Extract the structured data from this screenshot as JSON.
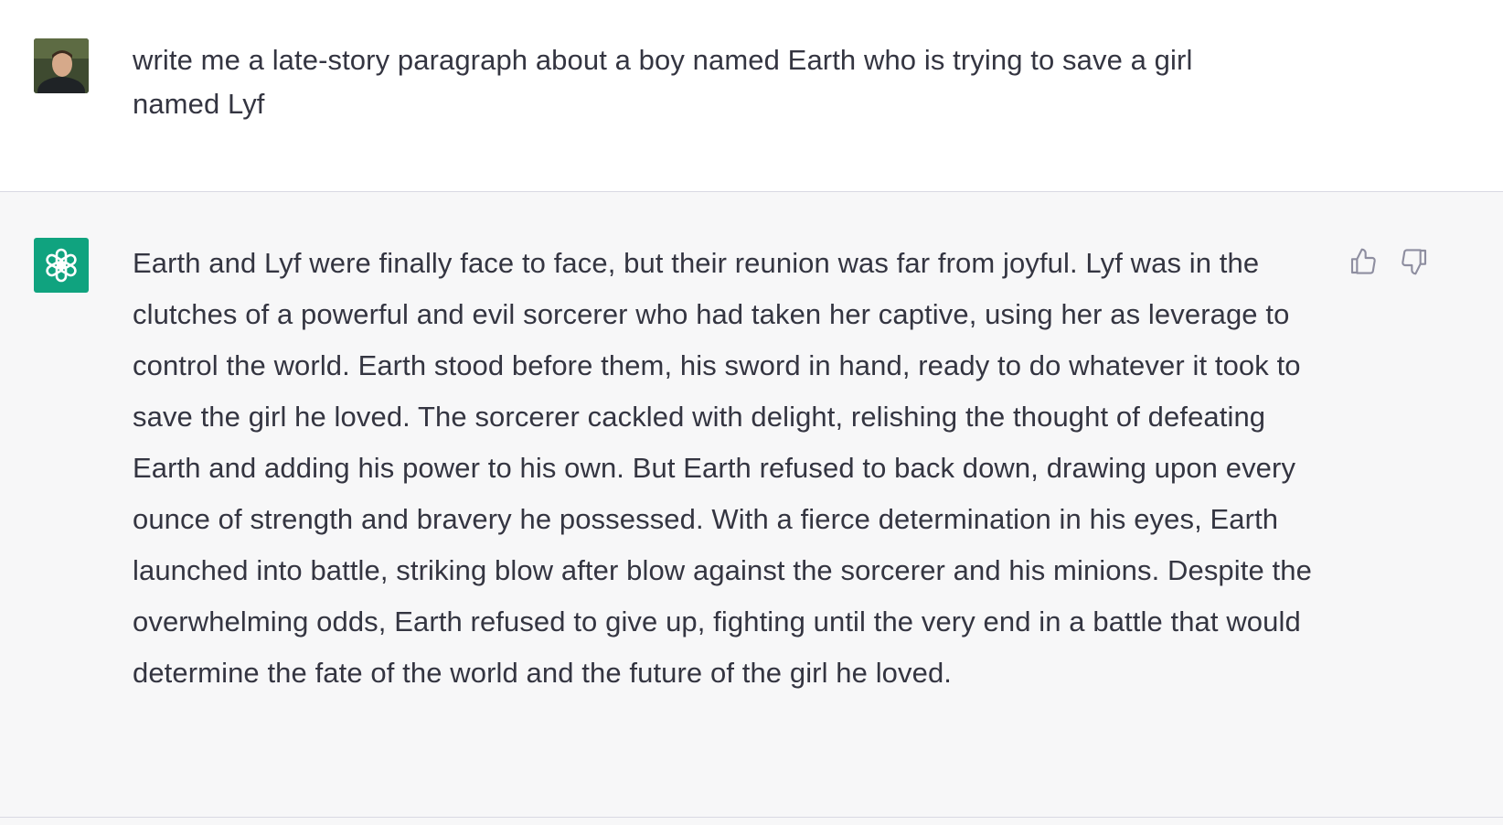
{
  "conversation": {
    "user_message": "write me a late-story paragraph about a boy named Earth who is trying to save a girl named Lyf",
    "assistant_message": "Earth and Lyf were finally face to face, but their reunion was far from joyful. Lyf was in the clutches of a powerful and evil sorcerer who had taken her captive, using her as leverage to control the world. Earth stood before them, his sword in hand, ready to do whatever it took to save the girl he loved. The sorcerer cackled with delight, relishing the thought of defeating Earth and adding his power to his own. But Earth refused to back down, drawing upon every ounce of strength and bravery he possessed. With a fierce determination in his eyes, Earth launched into battle, striking blow after blow against the sorcerer and his minions. Despite the overwhelming odds, Earth refused to give up, fighting until the very end in a battle that would determine the fate of the world and the future of the girl he loved."
  },
  "icons": {
    "user_avatar": "user-avatar-photo",
    "assistant_avatar": "openai-logo-icon",
    "feedback_up": "thumbs-up-icon",
    "feedback_down": "thumbs-down-icon"
  },
  "colors": {
    "assistant_avatar_bg": "#10a37f",
    "user_row_bg": "#ffffff",
    "assistant_row_bg": "#f7f7f8",
    "text": "#343541",
    "icon_gray": "#8e8ea0"
  }
}
